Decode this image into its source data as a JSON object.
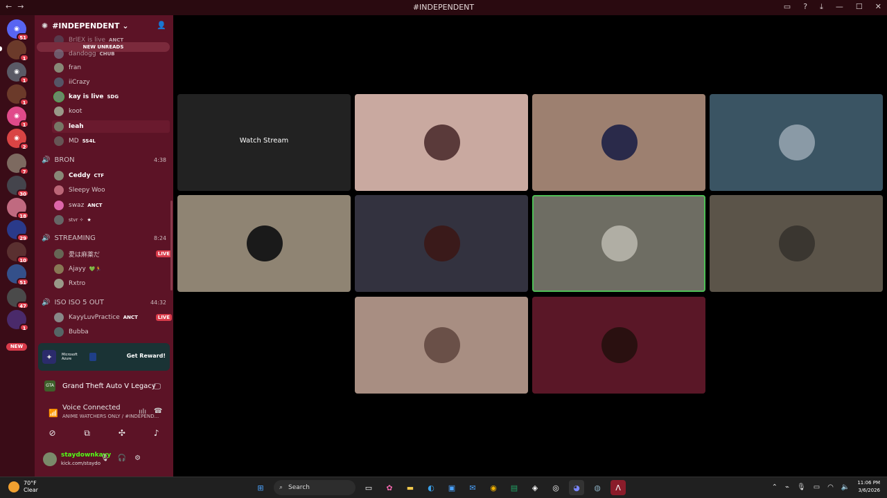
{
  "window": {
    "title": "#INDEPENDENT",
    "nav_back": "←",
    "nav_fwd": "→",
    "controls": [
      "▭",
      "?",
      "⤓",
      "—",
      "☐",
      "✕"
    ]
  },
  "server_rail": {
    "badges": [
      "51",
      "1",
      "1",
      "1",
      "1",
      "",
      "2",
      "7",
      "30",
      "18",
      "29",
      "10",
      "51",
      "47",
      "1"
    ],
    "new_label": "NEW"
  },
  "channel": {
    "name": "#INDEPENDENT",
    "new_unreads": "NEW UNREADS",
    "partial_top": "BrlEX is live",
    "partial_top_tag": "ANCT",
    "peers_a": [
      {
        "name": "dandogg",
        "tag": "CHUB"
      },
      {
        "name": "fran",
        "tag": ""
      },
      {
        "name": "iiCrazy",
        "tag": ""
      },
      {
        "name": "kay is live",
        "tag": "SDG"
      },
      {
        "name": "koot",
        "tag": ""
      },
      {
        "name": "leah",
        "tag": ""
      },
      {
        "name": "MD",
        "tag": "SS4L"
      }
    ],
    "voice_channels": [
      {
        "name": "BRON",
        "time": "4:38"
      },
      {
        "name": "STREAMING",
        "time": "8:24"
      },
      {
        "name": "ISO ISO 5 OUT",
        "time": "44:32"
      }
    ],
    "peers_bron": [
      {
        "name": "Ceddy",
        "tag": "CTF"
      },
      {
        "name": "Sleepy Woo",
        "tag": ""
      },
      {
        "name": "swaz",
        "tag": "ANCT"
      },
      {
        "name": "stvr ✧",
        "tag": "★"
      }
    ],
    "peers_streaming": [
      {
        "name": "愛は麻薬だ",
        "tag": "",
        "live": "LIVE"
      },
      {
        "name": "Ajayy",
        "tag": "💚🏃"
      },
      {
        "name": "Rxtro",
        "tag": ""
      }
    ],
    "peers_iso": [
      {
        "name": "KayyLuvPractice",
        "tag": "ANCT",
        "live": "LIVE"
      },
      {
        "name": "Bubba",
        "tag": ""
      }
    ]
  },
  "promo": {
    "brand_text": "Microsoft Azure",
    "cta": "Get Reward!"
  },
  "activity": {
    "game": "Grand Theft Auto V Legacy",
    "icon_text": "GTA"
  },
  "voice": {
    "status": "Voice Connected",
    "location": "ANIME WATCHERS ONLY / #INDEPEND..."
  },
  "user": {
    "name": "staydownkayy",
    "link": "kick.com/staydo"
  },
  "stage": {
    "watch_stream": "Watch Stream"
  },
  "tile_colors": [
    "#2b2b2b",
    "#c9a9a0",
    "#9d8070",
    "#3a5463",
    "#8f8473",
    "#33323f",
    "#6e6d63",
    "#5b5449",
    "#a88e82",
    "#5a1727"
  ],
  "taskbar": {
    "temp": "70°F",
    "condition": "Clear",
    "search": "Search",
    "time": "11:06 PM",
    "date": "3/6/2026"
  },
  "colors": {
    "channel_bg": "#5c1326",
    "rail_bg": "#3a0c17",
    "live_red": "#d93b4a",
    "speaking_green": "#4fbf56",
    "voice_green": "#67c99a"
  }
}
